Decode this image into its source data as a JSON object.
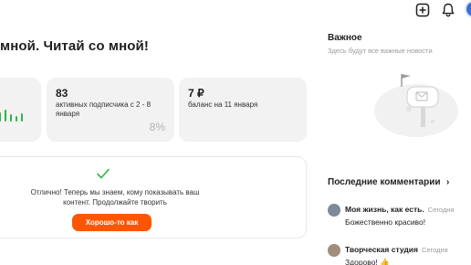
{
  "header": {
    "add_icon": "plus-square-icon",
    "bell_icon": "bell-icon",
    "avatar_icon": "user-avatar"
  },
  "main": {
    "title": "мной. Читай со мной!",
    "cards": [
      {
        "value": "83",
        "label": "активных подписчика с 2 - 8 января",
        "percent": "8%"
      },
      {
        "value": "7 ₽",
        "label": "баланс на 11 января"
      }
    ],
    "notice": {
      "text": "Отлично! Теперь мы знаем, кому показывать ваш контент. Продолжайте творить",
      "button": "Хорошо-то как"
    }
  },
  "sidebar": {
    "important_title": "Важное",
    "important_sub": "Здесь будут все важные новости",
    "comments_title": "Последние комментарии",
    "comments": [
      {
        "author": "Моя жизнь, как есть.",
        "time": "Сегодня",
        "text": "Божественно красиво!"
      },
      {
        "author": "Творческая студия",
        "time": "Сегодня",
        "text": "Здорово! 👍"
      }
    ]
  },
  "colors": {
    "accent": "#ff5500",
    "success": "#2fb44a",
    "card_bg": "#f2f2f2"
  }
}
